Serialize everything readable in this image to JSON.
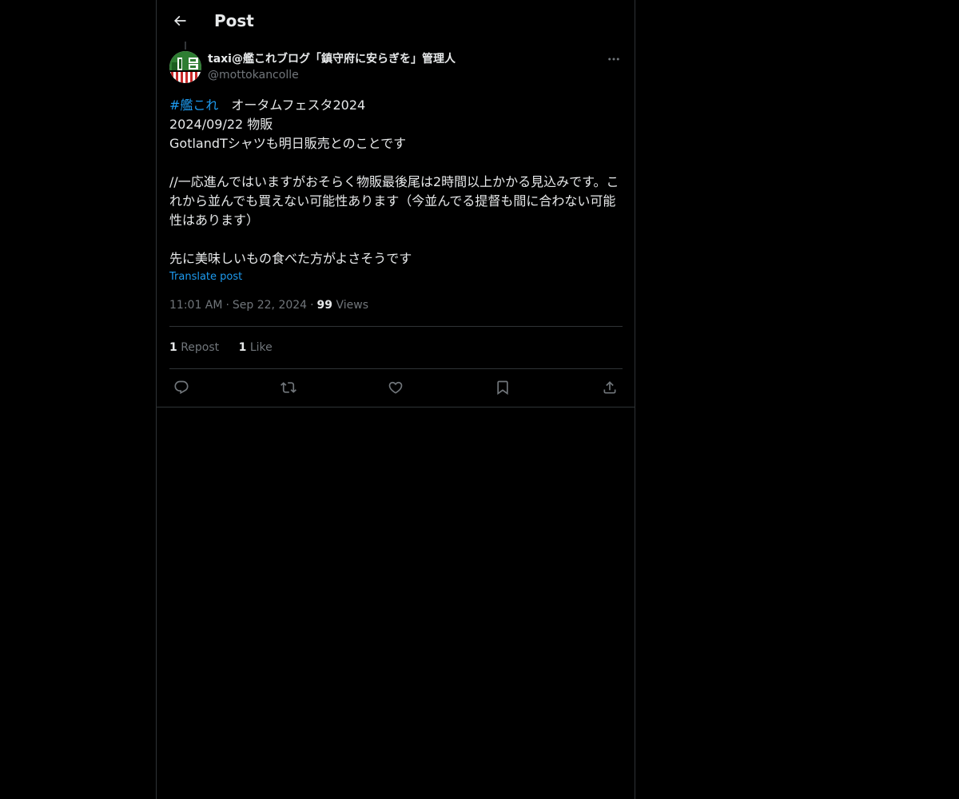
{
  "header": {
    "title": "Post",
    "back_icon": "arrow-left-icon"
  },
  "post": {
    "author": {
      "name": "taxi@艦これブログ「鎮守府に安らぎを」管理人",
      "handle": "@mottokancolle",
      "avatar_colors": [
        "#2e7d32",
        "#c62828",
        "#ffffff"
      ]
    },
    "text": {
      "hashtag": "#艦これ",
      "line1_rest": "　オータムフェスタ2024",
      "line2": "2024/09/22 物販",
      "line3": "GotlandTシャツも明日販売とのことです",
      "line4": "//一応進んではいますがおそらく物販最後尾は2時間以上かかる見込みです。これから並んでも買えない可能性あります（今並んでる提督も間に合わない可能性はあります）",
      "line5": "先に美味しいもの食べた方がよさそうです"
    },
    "translate_label": "Translate post",
    "time": "11:01 AM",
    "date": "Sep 22, 2024",
    "views_count": "99",
    "views_label": "Views",
    "reposts_count": "1",
    "reposts_label": "Repost",
    "likes_count": "1",
    "likes_label": "Like"
  },
  "actions": [
    "reply-icon",
    "repost-icon",
    "like-icon",
    "bookmark-icon",
    "share-icon"
  ],
  "colors": {
    "background": "#000000",
    "text": "#e7e9ea",
    "secondary": "#71767b",
    "accent": "#1d9bf0",
    "border": "#2f3336"
  }
}
